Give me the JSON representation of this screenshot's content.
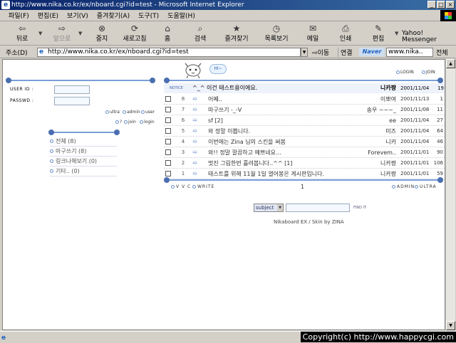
{
  "window": {
    "title": "http://www.nika.co.kr/ex/nboard.cgi?id=test - Microsoft Internet Explorer"
  },
  "menu": [
    "파일(F)",
    "편집(E)",
    "보기(V)",
    "즐겨찾기(A)",
    "도구(T)",
    "도움말(H)"
  ],
  "toolbar": {
    "back": "뒤로",
    "forward": "앞으로",
    "stop": "중지",
    "refresh": "새로고침",
    "home": "홈",
    "search": "검색",
    "favorites": "즐겨찾기",
    "history": "목록보기",
    "mail": "메일",
    "print": "인쇄",
    "edit": "편집",
    "yahoo_1": "Yahoo!",
    "yahoo_2": "Messenger"
  },
  "address": {
    "label": "주소(D)",
    "url": "http://www.nika.co.kr/ex/nboard.cgi?id=test",
    "go": "이동",
    "links": "연결",
    "naver": "Naver",
    "search_value": "www.nika..",
    "all": "전체"
  },
  "page": {
    "hi": "HI~",
    "top_links": {
      "login": "LOGIN",
      "join": "JOIN"
    },
    "login_form": {
      "userid_label": "USER ID :",
      "passwd_label": "PASSWD :"
    },
    "user_links": {
      "ultra": "ultra",
      "admin": "admin",
      "user": "user",
      "help": "?",
      "join": "join",
      "login": "login"
    },
    "categories": [
      "전체 (8)",
      "마구쓰기 (8)",
      "링크나해보기 (0)",
      "기타.. (0)"
    ],
    "notice": {
      "tag": "NOTICE",
      "subject": "^_^ 이건 태스트용이에요.",
      "author": "니카짱",
      "date": "2001/11/04",
      "hits": "19"
    },
    "posts": [
      {
        "num": "8",
        "subject": "어쩨..",
        "author": "이뽀여",
        "date": "2001/11/13",
        "hits": "1"
      },
      {
        "num": "7",
        "subject": "마구쓰기 -_-V",
        "author": "송우 ~~~_",
        "date": "2001/11/08",
        "hits": "11"
      },
      {
        "num": "6",
        "subject": "sf [2]",
        "author": "ee",
        "date": "2001/11/04",
        "hits": "27"
      },
      {
        "num": "5",
        "subject": "와 정말 이쁩니다.",
        "author": "미즈",
        "date": "2001/11/04",
        "hits": "64"
      },
      {
        "num": "4",
        "subject": "이번에는 Zina 님의 스킨을 써봄",
        "author": "니카",
        "date": "2001/11/04",
        "hits": "46"
      },
      {
        "num": "3",
        "subject": "와!! 정말 깔끔하고 예쁘네요...",
        "author": "Forevem..",
        "date": "2001/11/01",
        "hits": "90"
      },
      {
        "num": "2",
        "subject": "멋진 그림한번 흘려봅니다..^^ [1]",
        "author": "니카짱",
        "date": "2001/11/01",
        "hits": "106"
      },
      {
        "num": "1",
        "subject": "태스트를 위해 11월 1일 열어봉은 게시판입니다.",
        "author": "니카짱",
        "date": "2001/11/01",
        "hits": "59"
      }
    ],
    "footer": {
      "vvc": "V V C",
      "write": "WRITE",
      "page": "1",
      "admin": "ADMIN",
      "ultra": "ULTRA"
    },
    "search": {
      "select": "subject",
      "button": "FIND IT"
    },
    "credit": "Nikaboard EX / Skin by ZINA"
  },
  "status": {
    "copyright": "Copyright(c) http://www.happycgi.com"
  }
}
